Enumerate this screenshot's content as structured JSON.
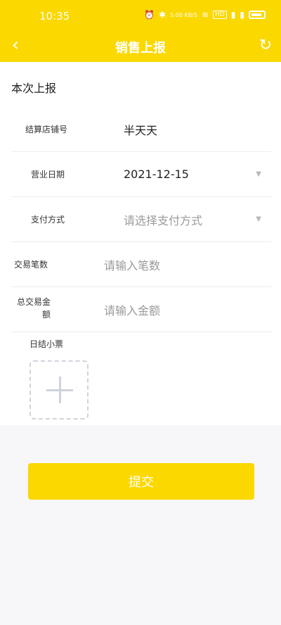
{
  "status": {
    "time": "10:35",
    "net_speed": "5.00 KB/S",
    "signal_text": "HD"
  },
  "nav": {
    "title": "销售上报"
  },
  "form": {
    "section_title": "本次上报",
    "store_label": "结算店铺号",
    "store_value": "半天天",
    "date_label": "营业日期",
    "date_value": "2021-12-15",
    "payment_label": "支付方式",
    "payment_placeholder": "请选择支付方式",
    "txn_count_label": "交易笔数",
    "txn_count_placeholder": "请输入笔数",
    "total_amount_label": "总交易金额",
    "total_amount_placeholder": "请输入金额",
    "ticket_label": "日结小票"
  },
  "actions": {
    "submit_label": "提交"
  },
  "colors": {
    "accent": "#fbd800",
    "background": "#f7f7f9"
  }
}
